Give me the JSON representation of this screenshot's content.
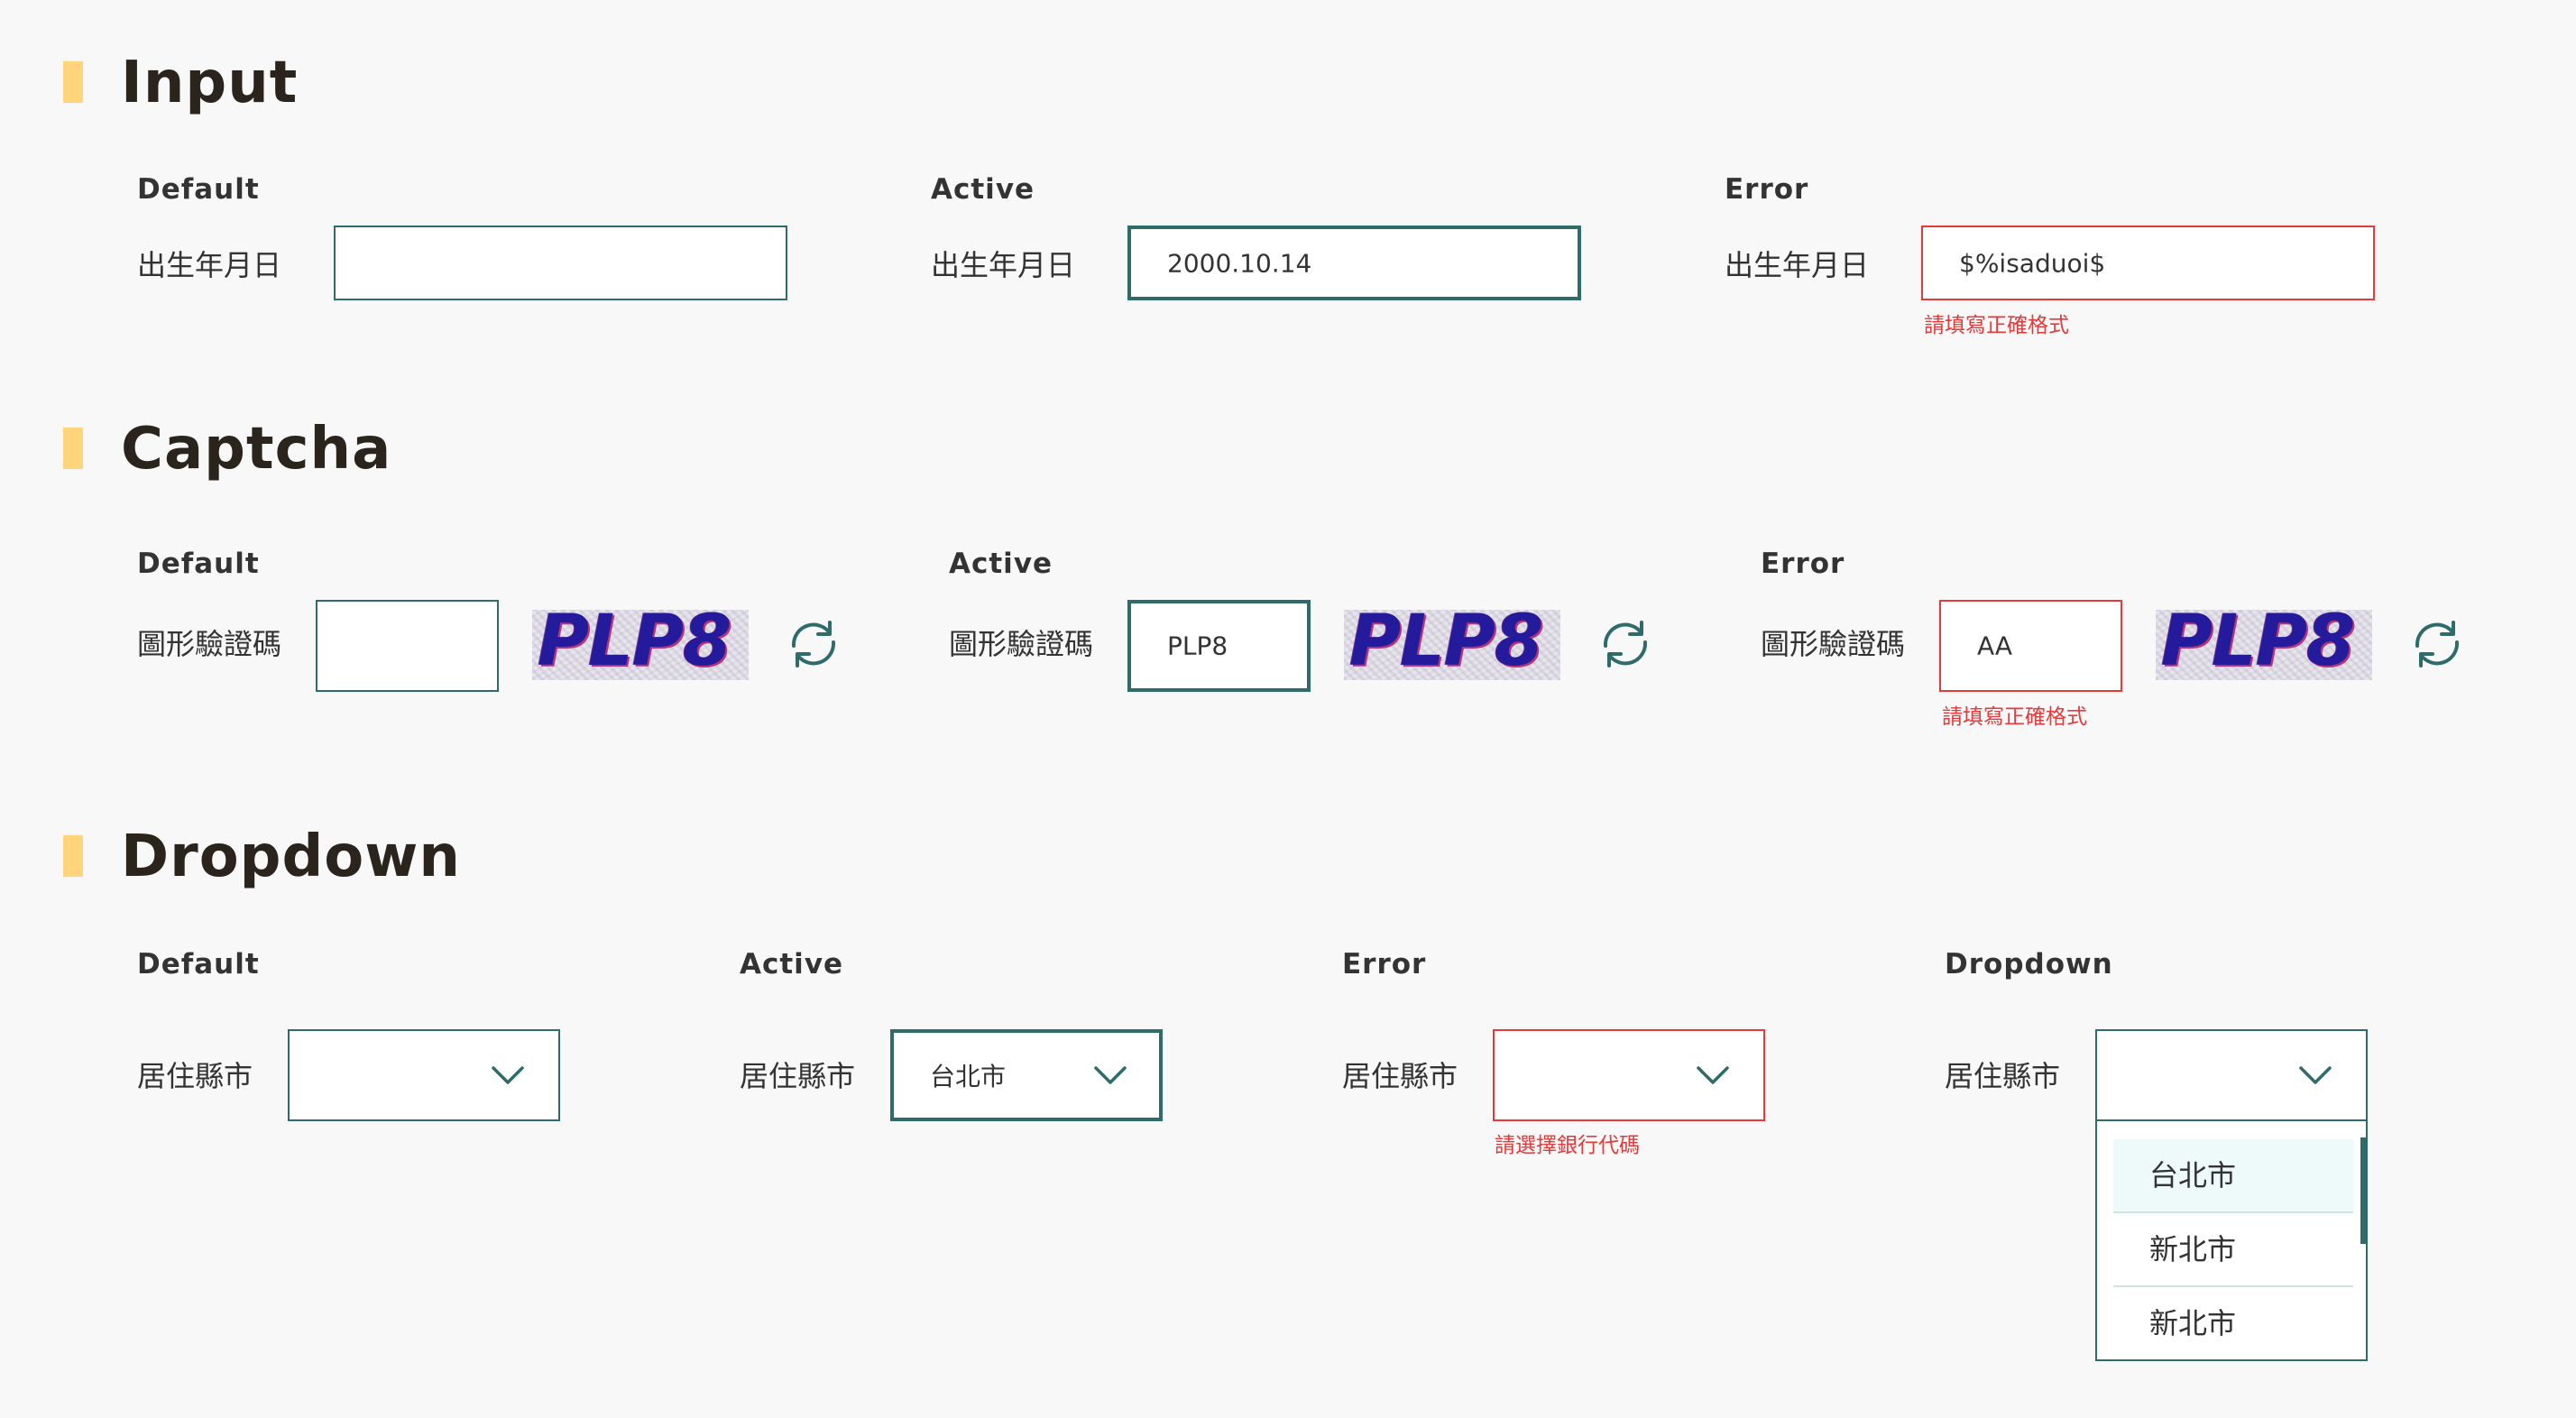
{
  "sections": {
    "input": {
      "title": "Input",
      "states": {
        "default": {
          "label": "Default",
          "field_label": "出生年月日",
          "value": ""
        },
        "active": {
          "label": "Active",
          "field_label": "出生年月日",
          "value": "2000.10.14"
        },
        "error": {
          "label": "Error",
          "field_label": "出生年月日",
          "value": "$%isaduoi$",
          "error": "請填寫正確格式"
        }
      }
    },
    "captcha": {
      "title": "Captcha",
      "image_text": "PLP8",
      "refresh_icon": "refresh-icon",
      "states": {
        "default": {
          "label": "Default",
          "field_label": "圖形驗證碼",
          "value": ""
        },
        "active": {
          "label": "Active",
          "field_label": "圖形驗證碼",
          "value": "PLP8"
        },
        "error": {
          "label": "Error",
          "field_label": "圖形驗證碼",
          "value": "AA",
          "error": "請填寫正確格式"
        }
      }
    },
    "dropdown": {
      "title": "Dropdown",
      "chevron_icon": "chevron-down-icon",
      "states": {
        "default": {
          "label": "Default",
          "field_label": "居住縣市",
          "value": ""
        },
        "active": {
          "label": "Active",
          "field_label": "居住縣市",
          "value": "台北市"
        },
        "error": {
          "label": "Error",
          "field_label": "居住縣市",
          "value": "",
          "error": "請選擇銀行代碼"
        },
        "open": {
          "label": "Dropdown",
          "field_label": "居住縣市",
          "value": "",
          "options": [
            "台北市",
            "新北市",
            "新北市"
          ]
        }
      }
    }
  },
  "colors": {
    "accent": "#2f6b6b",
    "error": "#e53a3a",
    "marker": "#ffd47a",
    "selected_bg": "#eefaf9",
    "background": "#f8f8f8"
  }
}
